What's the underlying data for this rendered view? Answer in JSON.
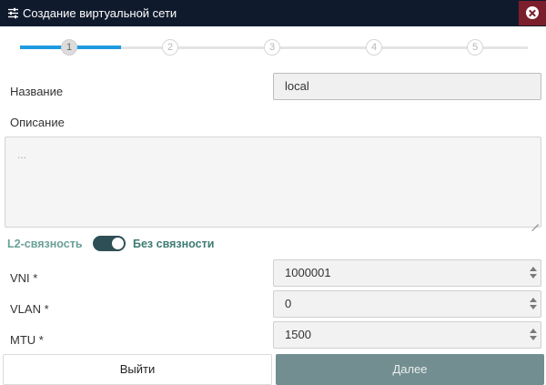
{
  "window": {
    "title": "Создание виртуальной сети",
    "title_icon": "sliders-icon",
    "close_icon": "close-circle-icon",
    "colors": {
      "titlebar": "#0f1b2d",
      "close": "#7a1f2b"
    }
  },
  "stepper": {
    "steps": [
      "1",
      "2",
      "3",
      "4",
      "5"
    ],
    "current_step": 1,
    "progress_color": "#1e9be0"
  },
  "form": {
    "name_label": "Название",
    "name_value": "local",
    "description_label": "Описание",
    "description_placeholder": "...",
    "l2_label": "L2-связность",
    "l2_toggle_on": true,
    "l2_state_label": "Без связности",
    "vni_label": "VNI *",
    "vni_value": "1000001",
    "vlan_label": "VLAN *",
    "vlan_value": "0",
    "mtu_label": "MTU *",
    "mtu_value": "1500"
  },
  "footer": {
    "exit_label": "Выйти",
    "next_label": "Далее",
    "next_color": "#728e90"
  }
}
